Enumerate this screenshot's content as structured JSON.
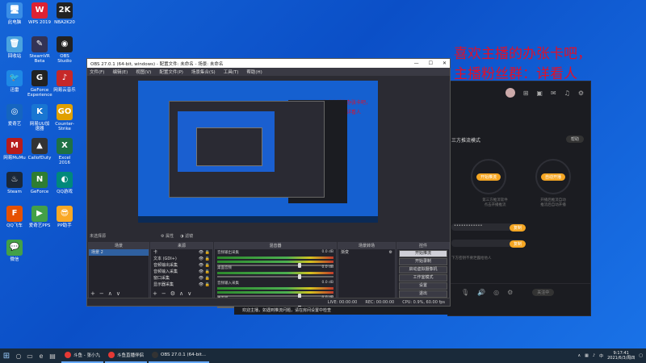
{
  "desktop": {
    "icons": [
      {
        "label": "此电脑",
        "glyph": "🖥",
        "color": "#3a8ee6"
      },
      {
        "label": "WPS 2019",
        "glyph": "W",
        "color": "#d23"
      },
      {
        "label": "NBA2K20",
        "glyph": "2K",
        "color": "#222"
      },
      {
        "label": "回收站",
        "glyph": "🗑",
        "color": "#4aa3df"
      },
      {
        "label": "SteamVR Beta",
        "glyph": "✎",
        "color": "#335"
      },
      {
        "label": "OBS Studio",
        "glyph": "◉",
        "color": "#222"
      },
      {
        "label": "迅雷",
        "glyph": "🐦",
        "color": "#1e88e5"
      },
      {
        "label": "GeForce Experience",
        "glyph": "G",
        "color": "#222"
      },
      {
        "label": "网易云音乐",
        "glyph": "♪",
        "color": "#c62828"
      },
      {
        "label": "爱奇艺",
        "glyph": "◎",
        "color": "#1565c0"
      },
      {
        "label": "网易UU加速器",
        "glyph": "K",
        "color": "#1976d2"
      },
      {
        "label": "Counter-Strike",
        "glyph": "GO",
        "color": "#e0a000"
      },
      {
        "label": "网易MuMu",
        "glyph": "M",
        "color": "#b71c1c"
      },
      {
        "label": "CallofDuty",
        "glyph": "▲",
        "color": "#333"
      },
      {
        "label": "Excel 2016",
        "glyph": "X",
        "color": "#1e7145"
      },
      {
        "label": "Steam",
        "glyph": "♨",
        "color": "#1b2838"
      },
      {
        "label": "GeForce",
        "glyph": "N",
        "color": "#2e7d32"
      },
      {
        "label": "QQ游戏",
        "glyph": "◐",
        "color": "#00897b"
      },
      {
        "label": "QQ飞车",
        "glyph": "F",
        "color": "#e65100"
      },
      {
        "label": "爱奇艺PPS",
        "glyph": "▶",
        "color": "#43a047"
      },
      {
        "label": "PP助手",
        "glyph": "😎",
        "color": "#f9a825"
      },
      {
        "label": "微信",
        "glyph": "💬",
        "color": "#43a047"
      }
    ],
    "overlay_line1": "喜欢主播的办张卡吧，",
    "overlay_line2": "主播粉丝群：详看人"
  },
  "obs": {
    "title": "OBS 27.0.1 (64-bit, windows) - 配置文件: 未命名 - 场景: 未命名",
    "menu": [
      "文件(F)",
      "编辑(E)",
      "视图(V)",
      "配置文件(P)",
      "场景集合(S)",
      "工具(T)",
      "帮助(H)"
    ],
    "no_source": "未选择源",
    "props_label": "属性",
    "filters_label": "滤镜",
    "scenes": {
      "header": "场景",
      "items": [
        "场景 2"
      ]
    },
    "sources": {
      "header": "来源",
      "items": [
        "卡",
        "文本 (GDI+)",
        "音频输出采集",
        "音频输入采集",
        "窗口采集",
        "显示器采集"
      ]
    },
    "mixer": {
      "header": "混音器",
      "channels": [
        {
          "name": "音频输出采集",
          "db": "0.0 dB"
        },
        {
          "name": "桌面音频",
          "db": "0.0 dB"
        },
        {
          "name": "音频输入采集",
          "db": "0.0 dB"
        },
        {
          "name": "麦克风",
          "db": "0.0 dB"
        }
      ]
    },
    "transitions": {
      "header": "场景转场",
      "value": "渐变"
    },
    "controls": {
      "header": "控件",
      "buttons": [
        "开始推流",
        "开始录制",
        "启动虚拟摄像机",
        "工作室模式",
        "设置",
        "退出"
      ]
    },
    "status": {
      "live": "LIVE: 00:00:00",
      "rec": "REC: 00:00:00",
      "cpu": "CPU: 0.9%, 60.00 fps"
    },
    "notice": "欢迎主播，如遇到推流问题，请在房间设置中检查"
  },
  "right_app": {
    "mode_label": "三方推流模式",
    "help_btn": "帮助",
    "circle1_btn": "开始推流",
    "circle1_t1": "第三方推流软件",
    "circle1_t2": "点击开播推流",
    "circle2_btn": "自动开播",
    "circle2_t1": "开播后推流自动",
    "circle2_t2": "推流后自动开播",
    "copy1": "复制",
    "copy2": "复制",
    "hint": "下方密钥不要泄露给他人",
    "bottom_btn": "关注中"
  },
  "taskbar": {
    "apps": [
      {
        "label": "斗鱼 - 张小九",
        "color": "#e53935"
      },
      {
        "label": "斗鱼直播伴侣",
        "color": "#e53935"
      },
      {
        "label": "OBS 27.0.1 (64-bit...",
        "color": "#333"
      }
    ],
    "time": "9:17:41",
    "date": "2021/6/3/周四",
    "tray_text": "中"
  }
}
